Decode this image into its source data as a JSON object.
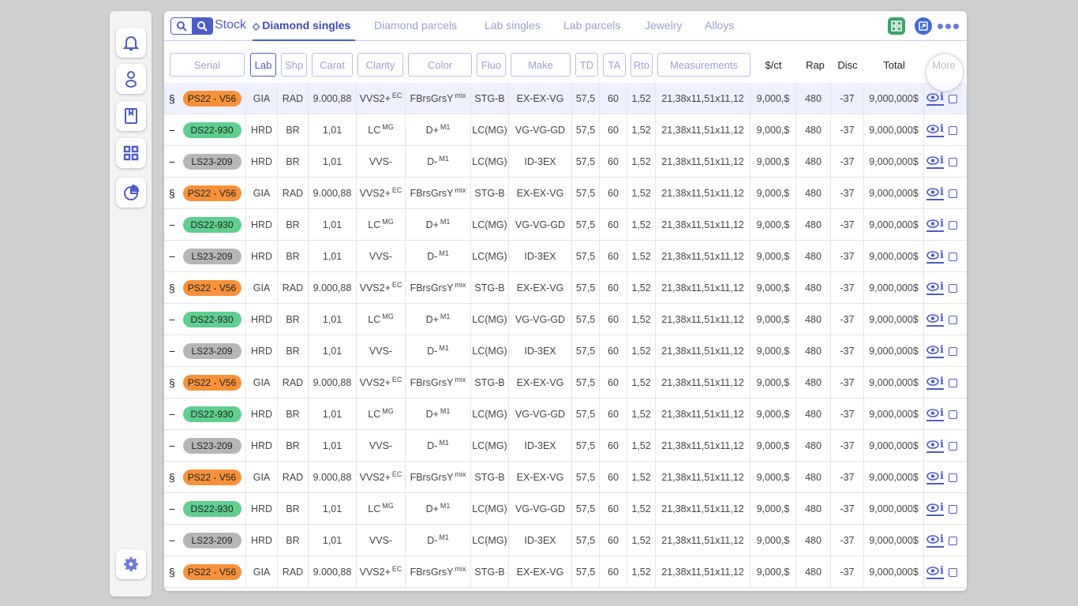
{
  "sidebar": {
    "items": [
      {
        "name": "bell-icon",
        "label": "Notifications"
      },
      {
        "name": "user-icon",
        "label": "Profile"
      },
      {
        "name": "book-icon",
        "label": "Catalog"
      },
      {
        "name": "grid-icon",
        "label": "Stock"
      },
      {
        "name": "pie-chart-icon",
        "label": "Reports"
      }
    ],
    "settings": "gear-icon"
  },
  "header": {
    "title": "Stock",
    "tabs": [
      {
        "label": "Diamond singles",
        "active": true
      },
      {
        "label": "Diamond parcels"
      },
      {
        "label": "Lab singles"
      },
      {
        "label": "Lab parcels"
      },
      {
        "label": "Jewelry"
      },
      {
        "label": "Alloys"
      }
    ]
  },
  "columns": {
    "serial": "Serial",
    "lab": "Lab",
    "shp": "Shp",
    "carat": "Carat",
    "clarity": "Clarity",
    "color": "Color",
    "fluo": "Fluo",
    "make": "Make",
    "td": "TD",
    "ta": "TA",
    "rto": "Rto",
    "measurements": "Measurements",
    "price": "$/ct",
    "rap": "Rap",
    "disc": "Disc",
    "total": "Total",
    "more": "More"
  },
  "rows": [
    {
      "lead": "§",
      "serial": "PS22 - V56",
      "badge": "orange",
      "lab": "GIA",
      "shp": "RAD",
      "carat": "9.000,88",
      "clarity": "VVS2+",
      "clarity_sup": "EC",
      "color": "FBrsGrsY",
      "color_sup": "mix",
      "fluo": "STG-B",
      "make": "EX-EX-VG",
      "td": "57,5",
      "ta": "60",
      "rto": "1,52",
      "meas": "21,38x11,51x11,12",
      "price": "9,000,$",
      "rap": "480",
      "disc": "-37",
      "total": "9,000,000$"
    },
    {
      "lead": "−",
      "serial": "DS22-930",
      "badge": "green",
      "lab": "HRD",
      "shp": "BR",
      "carat": "1,01",
      "clarity": "LC",
      "clarity_sup": "MG",
      "color": "D+",
      "color_sup": "M1",
      "fluo": "LC(MG)",
      "make": "VG-VG-GD",
      "td": "57,5",
      "ta": "60",
      "rto": "1,52",
      "meas": "21,38x11,51x11,12",
      "price": "9,000,$",
      "rap": "480",
      "disc": "-37",
      "total": "9,000,000$"
    },
    {
      "lead": "−",
      "serial": "LS23-209",
      "badge": "gray",
      "lab": "HRD",
      "shp": "BR",
      "carat": "1,01",
      "clarity": "VVS-",
      "clarity_sup": "",
      "color": "D-",
      "color_sup": "M1",
      "fluo": "LC(MG)",
      "make": "ID-3EX",
      "td": "57,5",
      "ta": "60",
      "rto": "1,52",
      "meas": "21,38x11,51x11,12",
      "price": "9,000,$",
      "rap": "480",
      "disc": "-37",
      "total": "9,000,000$"
    },
    {
      "lead": "§",
      "serial": "PS22 - V56",
      "badge": "orange",
      "lab": "GIA",
      "shp": "RAD",
      "carat": "9.000,88",
      "clarity": "VVS2+",
      "clarity_sup": "EC",
      "color": "FBrsGrsY",
      "color_sup": "mix",
      "fluo": "STG-B",
      "make": "EX-EX-VG",
      "td": "57,5",
      "ta": "60",
      "rto": "1,52",
      "meas": "21,38x11,51x11,12",
      "price": "9,000,$",
      "rap": "480",
      "disc": "-37",
      "total": "9,000,000$"
    },
    {
      "lead": "−",
      "serial": "DS22-930",
      "badge": "green",
      "lab": "HRD",
      "shp": "BR",
      "carat": "1,01",
      "clarity": "LC",
      "clarity_sup": "MG",
      "color": "D+",
      "color_sup": "M1",
      "fluo": "LC(MG)",
      "make": "VG-VG-GD",
      "td": "57,5",
      "ta": "60",
      "rto": "1,52",
      "meas": "21,38x11,51x11,12",
      "price": "9,000,$",
      "rap": "480",
      "disc": "-37",
      "total": "9,000,000$"
    },
    {
      "lead": "−",
      "serial": "LS23-209",
      "badge": "gray",
      "lab": "HRD",
      "shp": "BR",
      "carat": "1,01",
      "clarity": "VVS-",
      "clarity_sup": "",
      "color": "D-",
      "color_sup": "M1",
      "fluo": "LC(MG)",
      "make": "ID-3EX",
      "td": "57,5",
      "ta": "60",
      "rto": "1,52",
      "meas": "21,38x11,51x11,12",
      "price": "9,000,$",
      "rap": "480",
      "disc": "-37",
      "total": "9,000,000$"
    },
    {
      "lead": "§",
      "serial": "PS22 - V56",
      "badge": "orange",
      "lab": "GIA",
      "shp": "RAD",
      "carat": "9.000,88",
      "clarity": "VVS2+",
      "clarity_sup": "EC",
      "color": "FBrsGrsY",
      "color_sup": "mix",
      "fluo": "STG-B",
      "make": "EX-EX-VG",
      "td": "57,5",
      "ta": "60",
      "rto": "1,52",
      "meas": "21,38x11,51x11,12",
      "price": "9,000,$",
      "rap": "480",
      "disc": "-37",
      "total": "9,000,000$"
    },
    {
      "lead": "−",
      "serial": "DS22-930",
      "badge": "green",
      "lab": "HRD",
      "shp": "BR",
      "carat": "1,01",
      "clarity": "LC",
      "clarity_sup": "MG",
      "color": "D+",
      "color_sup": "M1",
      "fluo": "LC(MG)",
      "make": "VG-VG-GD",
      "td": "57,5",
      "ta": "60",
      "rto": "1,52",
      "meas": "21,38x11,51x11,12",
      "price": "9,000,$",
      "rap": "480",
      "disc": "-37",
      "total": "9,000,000$"
    },
    {
      "lead": "−",
      "serial": "LS23-209",
      "badge": "gray",
      "lab": "HRD",
      "shp": "BR",
      "carat": "1,01",
      "clarity": "VVS-",
      "clarity_sup": "",
      "color": "D-",
      "color_sup": "M1",
      "fluo": "LC(MG)",
      "make": "ID-3EX",
      "td": "57,5",
      "ta": "60",
      "rto": "1,52",
      "meas": "21,38x11,51x11,12",
      "price": "9,000,$",
      "rap": "480",
      "disc": "-37",
      "total": "9,000,000$"
    },
    {
      "lead": "§",
      "serial": "PS22 - V56",
      "badge": "orange",
      "lab": "GIA",
      "shp": "RAD",
      "carat": "9.000,88",
      "clarity": "VVS2+",
      "clarity_sup": "EC",
      "color": "FBrsGrsY",
      "color_sup": "mix",
      "fluo": "STG-B",
      "make": "EX-EX-VG",
      "td": "57,5",
      "ta": "60",
      "rto": "1,52",
      "meas": "21,38x11,51x11,12",
      "price": "9,000,$",
      "rap": "480",
      "disc": "-37",
      "total": "9,000,000$"
    },
    {
      "lead": "−",
      "serial": "DS22-930",
      "badge": "green",
      "lab": "HRD",
      "shp": "BR",
      "carat": "1,01",
      "clarity": "LC",
      "clarity_sup": "MG",
      "color": "D+",
      "color_sup": "M1",
      "fluo": "LC(MG)",
      "make": "VG-VG-GD",
      "td": "57,5",
      "ta": "60",
      "rto": "1,52",
      "meas": "21,38x11,51x11,12",
      "price": "9,000,$",
      "rap": "480",
      "disc": "-37",
      "total": "9,000,000$"
    },
    {
      "lead": "−",
      "serial": "LS23-209",
      "badge": "gray",
      "lab": "HRD",
      "shp": "BR",
      "carat": "1,01",
      "clarity": "VVS-",
      "clarity_sup": "",
      "color": "D-",
      "color_sup": "M1",
      "fluo": "LC(MG)",
      "make": "ID-3EX",
      "td": "57,5",
      "ta": "60",
      "rto": "1,52",
      "meas": "21,38x11,51x11,12",
      "price": "9,000,$",
      "rap": "480",
      "disc": "-37",
      "total": "9,000,000$"
    },
    {
      "lead": "§",
      "serial": "PS22 - V56",
      "badge": "orange",
      "lab": "GIA",
      "shp": "RAD",
      "carat": "9.000,88",
      "clarity": "VVS2+",
      "clarity_sup": "EC",
      "color": "FBrsGrsY",
      "color_sup": "mix",
      "fluo": "STG-B",
      "make": "EX-EX-VG",
      "td": "57,5",
      "ta": "60",
      "rto": "1,52",
      "meas": "21,38x11,51x11,12",
      "price": "9,000,$",
      "rap": "480",
      "disc": "-37",
      "total": "9,000,000$"
    },
    {
      "lead": "−",
      "serial": "DS22-930",
      "badge": "green",
      "lab": "HRD",
      "shp": "BR",
      "carat": "1,01",
      "clarity": "LC",
      "clarity_sup": "MG",
      "color": "D+",
      "color_sup": "M1",
      "fluo": "LC(MG)",
      "make": "VG-VG-GD",
      "td": "57,5",
      "ta": "60",
      "rto": "1,52",
      "meas": "21,38x11,51x11,12",
      "price": "9,000,$",
      "rap": "480",
      "disc": "-37",
      "total": "9,000,000$"
    },
    {
      "lead": "−",
      "serial": "LS23-209",
      "badge": "gray",
      "lab": "HRD",
      "shp": "BR",
      "carat": "1,01",
      "clarity": "VVS-",
      "clarity_sup": "",
      "color": "D-",
      "color_sup": "M1",
      "fluo": "LC(MG)",
      "make": "ID-3EX",
      "td": "57,5",
      "ta": "60",
      "rto": "1,52",
      "meas": "21,38x11,51x11,12",
      "price": "9,000,$",
      "rap": "480",
      "disc": "-37",
      "total": "9,000,000$"
    },
    {
      "lead": "§",
      "serial": "PS22 - V56",
      "badge": "orange",
      "lab": "GIA",
      "shp": "RAD",
      "carat": "9.000,88",
      "clarity": "VVS2+",
      "clarity_sup": "EC",
      "color": "FBrsGrsY",
      "color_sup": "mix",
      "fluo": "STG-B",
      "make": "EX-EX-VG",
      "td": "57,5",
      "ta": "60",
      "rto": "1,52",
      "meas": "21,38x11,51x11,12",
      "price": "9,000,$",
      "rap": "480",
      "disc": "-37",
      "total": "9,000,000$"
    }
  ],
  "colors": {
    "accent": "#4e5cc9",
    "orange": "#f7923a",
    "green": "#5fce8e",
    "gray": "#b6b6b6"
  }
}
